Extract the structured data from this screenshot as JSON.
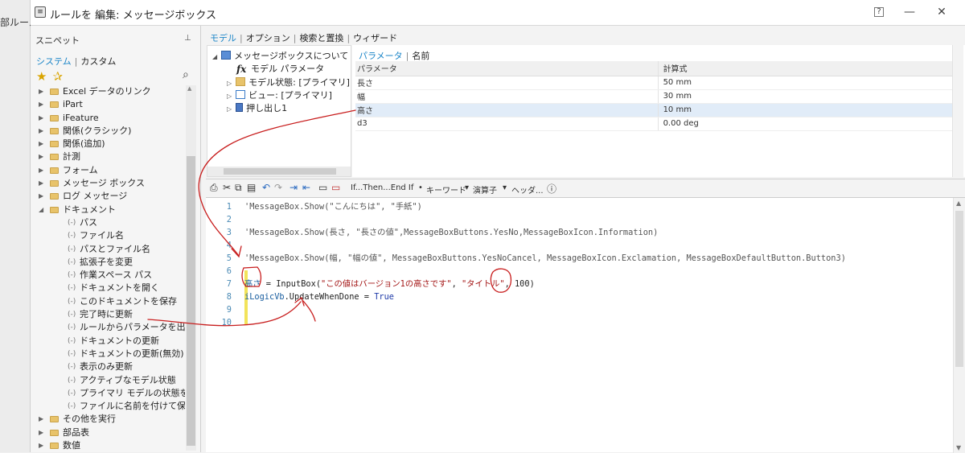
{
  "outer": {
    "cut_text": "部ルール"
  },
  "window": {
    "title": "ルールを 編集: メッセージボックス",
    "help_label": "?",
    "minimize_label": "—",
    "maximize_label": "☐",
    "close_label": "✕"
  },
  "snippets": {
    "header": "スニペット",
    "pin": "⊥",
    "tabs": {
      "system": "システム",
      "custom": "カスタム",
      "sep": "|"
    },
    "tree": [
      {
        "label": "Excel データのリンク",
        "type": "folder"
      },
      {
        "label": "iPart",
        "type": "folder"
      },
      {
        "label": "iFeature",
        "type": "folder"
      },
      {
        "label": "関係(クラシック)",
        "type": "folder"
      },
      {
        "label": "関係(追加)",
        "type": "folder"
      },
      {
        "label": "計測",
        "type": "folder"
      },
      {
        "label": "フォーム",
        "type": "folder"
      },
      {
        "label": "メッセージ ボックス",
        "type": "folder"
      },
      {
        "label": "ログ メッセージ",
        "type": "folder"
      },
      {
        "label": "ドキュメント",
        "type": "folder-open"
      },
      {
        "label": "パス",
        "type": "leaf"
      },
      {
        "label": "ファイル名",
        "type": "leaf"
      },
      {
        "label": "パスとファイル名",
        "type": "leaf"
      },
      {
        "label": "拡張子を変更",
        "type": "leaf"
      },
      {
        "label": "作業スペース パス",
        "type": "leaf"
      },
      {
        "label": "ドキュメントを開く",
        "type": "leaf"
      },
      {
        "label": "このドキュメントを保存",
        "type": "leaf"
      },
      {
        "label": "完了時に更新",
        "type": "leaf"
      },
      {
        "label": "ルールからパラメータを出力",
        "type": "leaf"
      },
      {
        "label": "ドキュメントの更新",
        "type": "leaf"
      },
      {
        "label": "ドキュメントの更新(無効)",
        "type": "leaf"
      },
      {
        "label": "表示のみ更新",
        "type": "leaf"
      },
      {
        "label": "アクティブなモデル状態",
        "type": "leaf"
      },
      {
        "label": "プライマリ モデルの状態をアクティ",
        "type": "leaf"
      },
      {
        "label": "ファイルに名前を付けて保存",
        "type": "leaf"
      },
      {
        "label": "その他を実行",
        "type": "folder"
      },
      {
        "label": "部品表",
        "type": "folder"
      },
      {
        "label": "数値",
        "type": "folder"
      }
    ]
  },
  "top_tabs": {
    "model": "モデル",
    "options": "オプション",
    "search": "検索と置換",
    "wizard": "ウィザード",
    "sep": "|"
  },
  "model_tree": {
    "root": "メッセージボックスについて",
    "params": "モデル パラメータ",
    "model_state": "モデル状態: [プライマリ]",
    "view": "ビュー: [プライマリ]",
    "extrude": "押し出し1"
  },
  "param_panel": {
    "tabs": {
      "params": "パラメータ",
      "name": "名前",
      "sep": "|"
    },
    "columns": [
      "パラメータ",
      "計算式"
    ],
    "rows": [
      {
        "name": "長さ",
        "formula": "50 mm"
      },
      {
        "name": "幅",
        "formula": "30 mm"
      },
      {
        "name": "高さ",
        "formula": "10 mm"
      },
      {
        "name": "d3",
        "formula": "0.00 deg"
      }
    ]
  },
  "toolbar": {
    "ifthen": "If...Then...End If",
    "keyword": "キーワード",
    "operator": "演算子",
    "header": "ヘッダ..."
  },
  "code": {
    "line_numbers": [
      "1",
      "2",
      "3",
      "4",
      "5",
      "6",
      "7",
      "8",
      "9",
      "10"
    ],
    "l1": "'MessageBox.Show(\"こんにちは\", \"手紙\")",
    "l3": "'MessageBox.Show(長さ, \"長さの値\",MessageBoxButtons.YesNo,MessageBoxIcon.Information)",
    "l5": "'MessageBox.Show(幅, \"幅の値\", MessageBoxButtons.YesNoCancel, MessageBoxIcon.Exclamation, MessageBoxDefaultButton.Button3)",
    "l7_var": "高さ",
    "l7_eq": " = ",
    "l7_func": "InputBox",
    "l7_open": "(",
    "l7_s1": "\"この値はバージョン1の高さです\"",
    "l7_c1": ", ",
    "l7_s2": "\"タイトル\"",
    "l7_c2": ", ",
    "l7_num": "100",
    "l7_close": ")",
    "l8_obj": "iLogicVb",
    "l8_member": ".UpdateWhenDone = ",
    "l8_val": "True"
  },
  "accent_color": "#1d86c8",
  "annotation_color": "#c81e1e"
}
